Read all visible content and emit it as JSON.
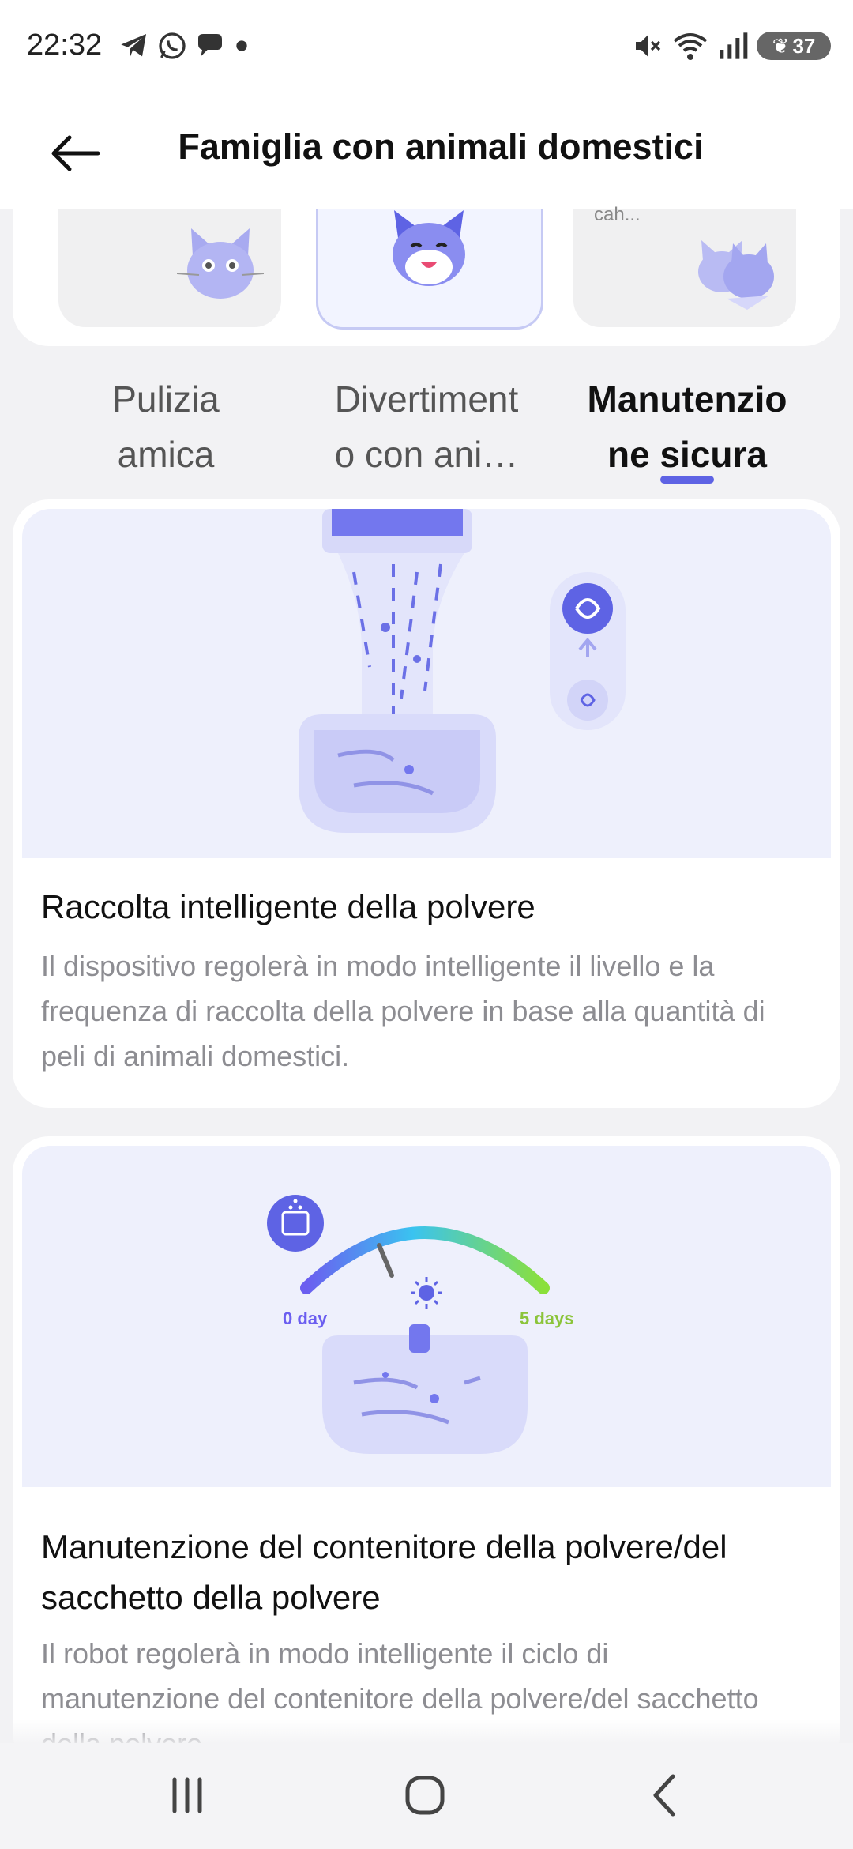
{
  "status": {
    "time": "22:32",
    "battery": "37"
  },
  "header": {
    "title": "Famiglia con animali domestici"
  },
  "modes": {
    "third_partial_label": "cah..."
  },
  "tabs": [
    {
      "label_line1": "Pulizia",
      "label_line2": "amica"
    },
    {
      "label_line1": "Divertiment",
      "label_line2": "o con ani…"
    },
    {
      "label_line1": "Manutenzio",
      "label_line2": "ne sicura"
    }
  ],
  "cards": [
    {
      "title": "Raccolta intelligente della polvere",
      "description": "Il dispositivo regolerà in modo intelligente il livello e la frequenza di raccolta della polvere in base alla quantità di peli di animali domestici."
    },
    {
      "title": "Manutenzione del contenitore della polvere/del sacchetto della polvere",
      "description": "Il robot regolerà in modo intelligente il ciclo di manutenzione del contenitore della polvere/del sacchetto della polvere",
      "gauge_min": "0 day",
      "gauge_max": "5 days"
    }
  ],
  "colors": {
    "accent": "#5e63e4",
    "illustration_bg": "#eef0fc"
  }
}
